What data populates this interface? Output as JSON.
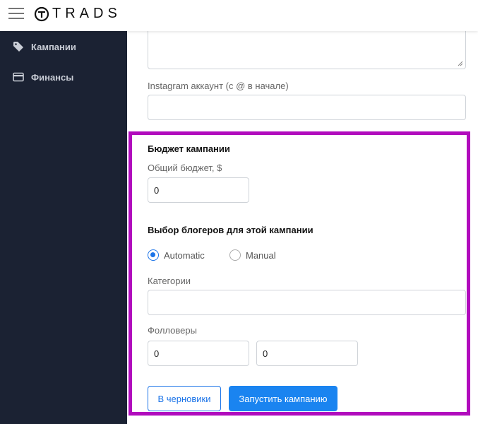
{
  "header": {
    "logo_text": "TRADS"
  },
  "sidebar": {
    "items": [
      {
        "label": "Кампании",
        "icon": "tag-icon"
      },
      {
        "label": "Финансы",
        "icon": "credit-card-icon"
      }
    ]
  },
  "form": {
    "description_placeholder": "",
    "instagram": {
      "label": "Instagram аккаунт (с @ в начале)",
      "value": ""
    },
    "budget": {
      "section_title": "Бюджет кампании",
      "total_label": "Общий бюджет, $",
      "total_value": "0"
    },
    "bloggers": {
      "section_title": "Выбор блогеров для этой кампании",
      "options": [
        {
          "label": "Automatic",
          "selected": true
        },
        {
          "label": "Manual",
          "selected": false
        }
      ],
      "categories_label": "Категории",
      "categories_value": "",
      "followers_label": "Фолловеры",
      "followers_min": "0",
      "followers_max": "0"
    },
    "buttons": {
      "draft": "В черновики",
      "launch": "Запустить кампанию"
    }
  },
  "colors": {
    "sidebar_bg": "#1b2233",
    "accent": "#1a84f0",
    "highlight": "#b10bbd"
  }
}
